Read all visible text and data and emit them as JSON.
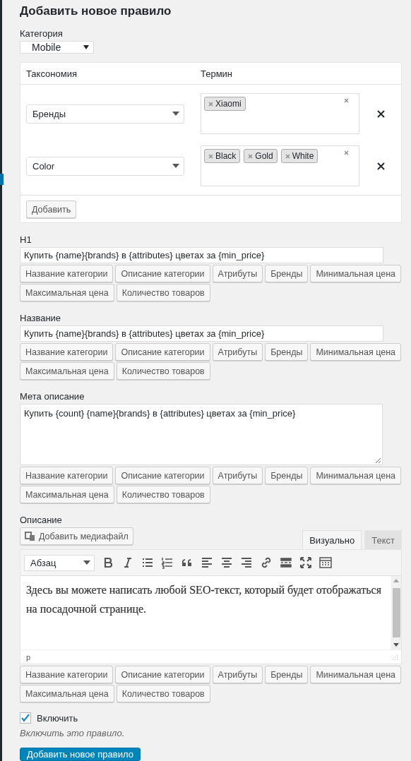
{
  "title": "Добавить новое правило",
  "category": {
    "label": "Категория",
    "value": "Mobile"
  },
  "taxonomy_table": {
    "columns": [
      "Таксономия",
      "Термин"
    ],
    "rows": [
      {
        "taxonomy": "Бренды",
        "terms": [
          "Xiaomi"
        ]
      },
      {
        "taxonomy": "Color",
        "terms": [
          "Black",
          "Gold",
          "White"
        ]
      }
    ],
    "add_button": "Добавить"
  },
  "fields": [
    {
      "kind": "input",
      "label": "H1",
      "value": "Купить {name}{brands} в {attributes} цветах за {min_price}",
      "buttons": [
        "Название категории",
        "Описание категории",
        "Атрибуты",
        "Бренды",
        "Минимальная цена",
        "Максимальная цена",
        "Количество товаров"
      ]
    },
    {
      "kind": "input",
      "label": "Название",
      "value": "Купить {name}{brands} в {attributes} цветах за {min_price}",
      "buttons": [
        "Название категории",
        "Описание категории",
        "Атрибуты",
        "Бренды",
        "Минимальная цена",
        "Максимальная цена",
        "Количество товаров"
      ]
    },
    {
      "kind": "textarea",
      "label": "Мета описание",
      "value": "Купить {count} {name}{brands} в {attributes} цветах за {min_price}",
      "buttons": [
        "Название категории",
        "Описание категории",
        "Атрибуты",
        "Бренды",
        "Минимальная цена",
        "Максимальная цена",
        "Количество товаров"
      ]
    }
  ],
  "description": {
    "label": "Описание",
    "media_button": "Добавить медиафайл",
    "tabs": [
      {
        "label": "Визуально",
        "selected": true
      },
      {
        "label": "Текст",
        "selected": false
      }
    ],
    "format": "Абзац",
    "content": "Здесь вы можете написать любой SEO-текст, который будет отображаться на посадочной странице.",
    "path": "p",
    "buttons": [
      "Название категории",
      "Описание категории",
      "Атрибуты",
      "Бренды",
      "Минимальная цена",
      "Максимальная цена",
      "Количество товаров"
    ]
  },
  "enable": {
    "label": "Включить",
    "checked": true,
    "hint": "Включить это правило."
  },
  "submit": "Добавить новое правило"
}
